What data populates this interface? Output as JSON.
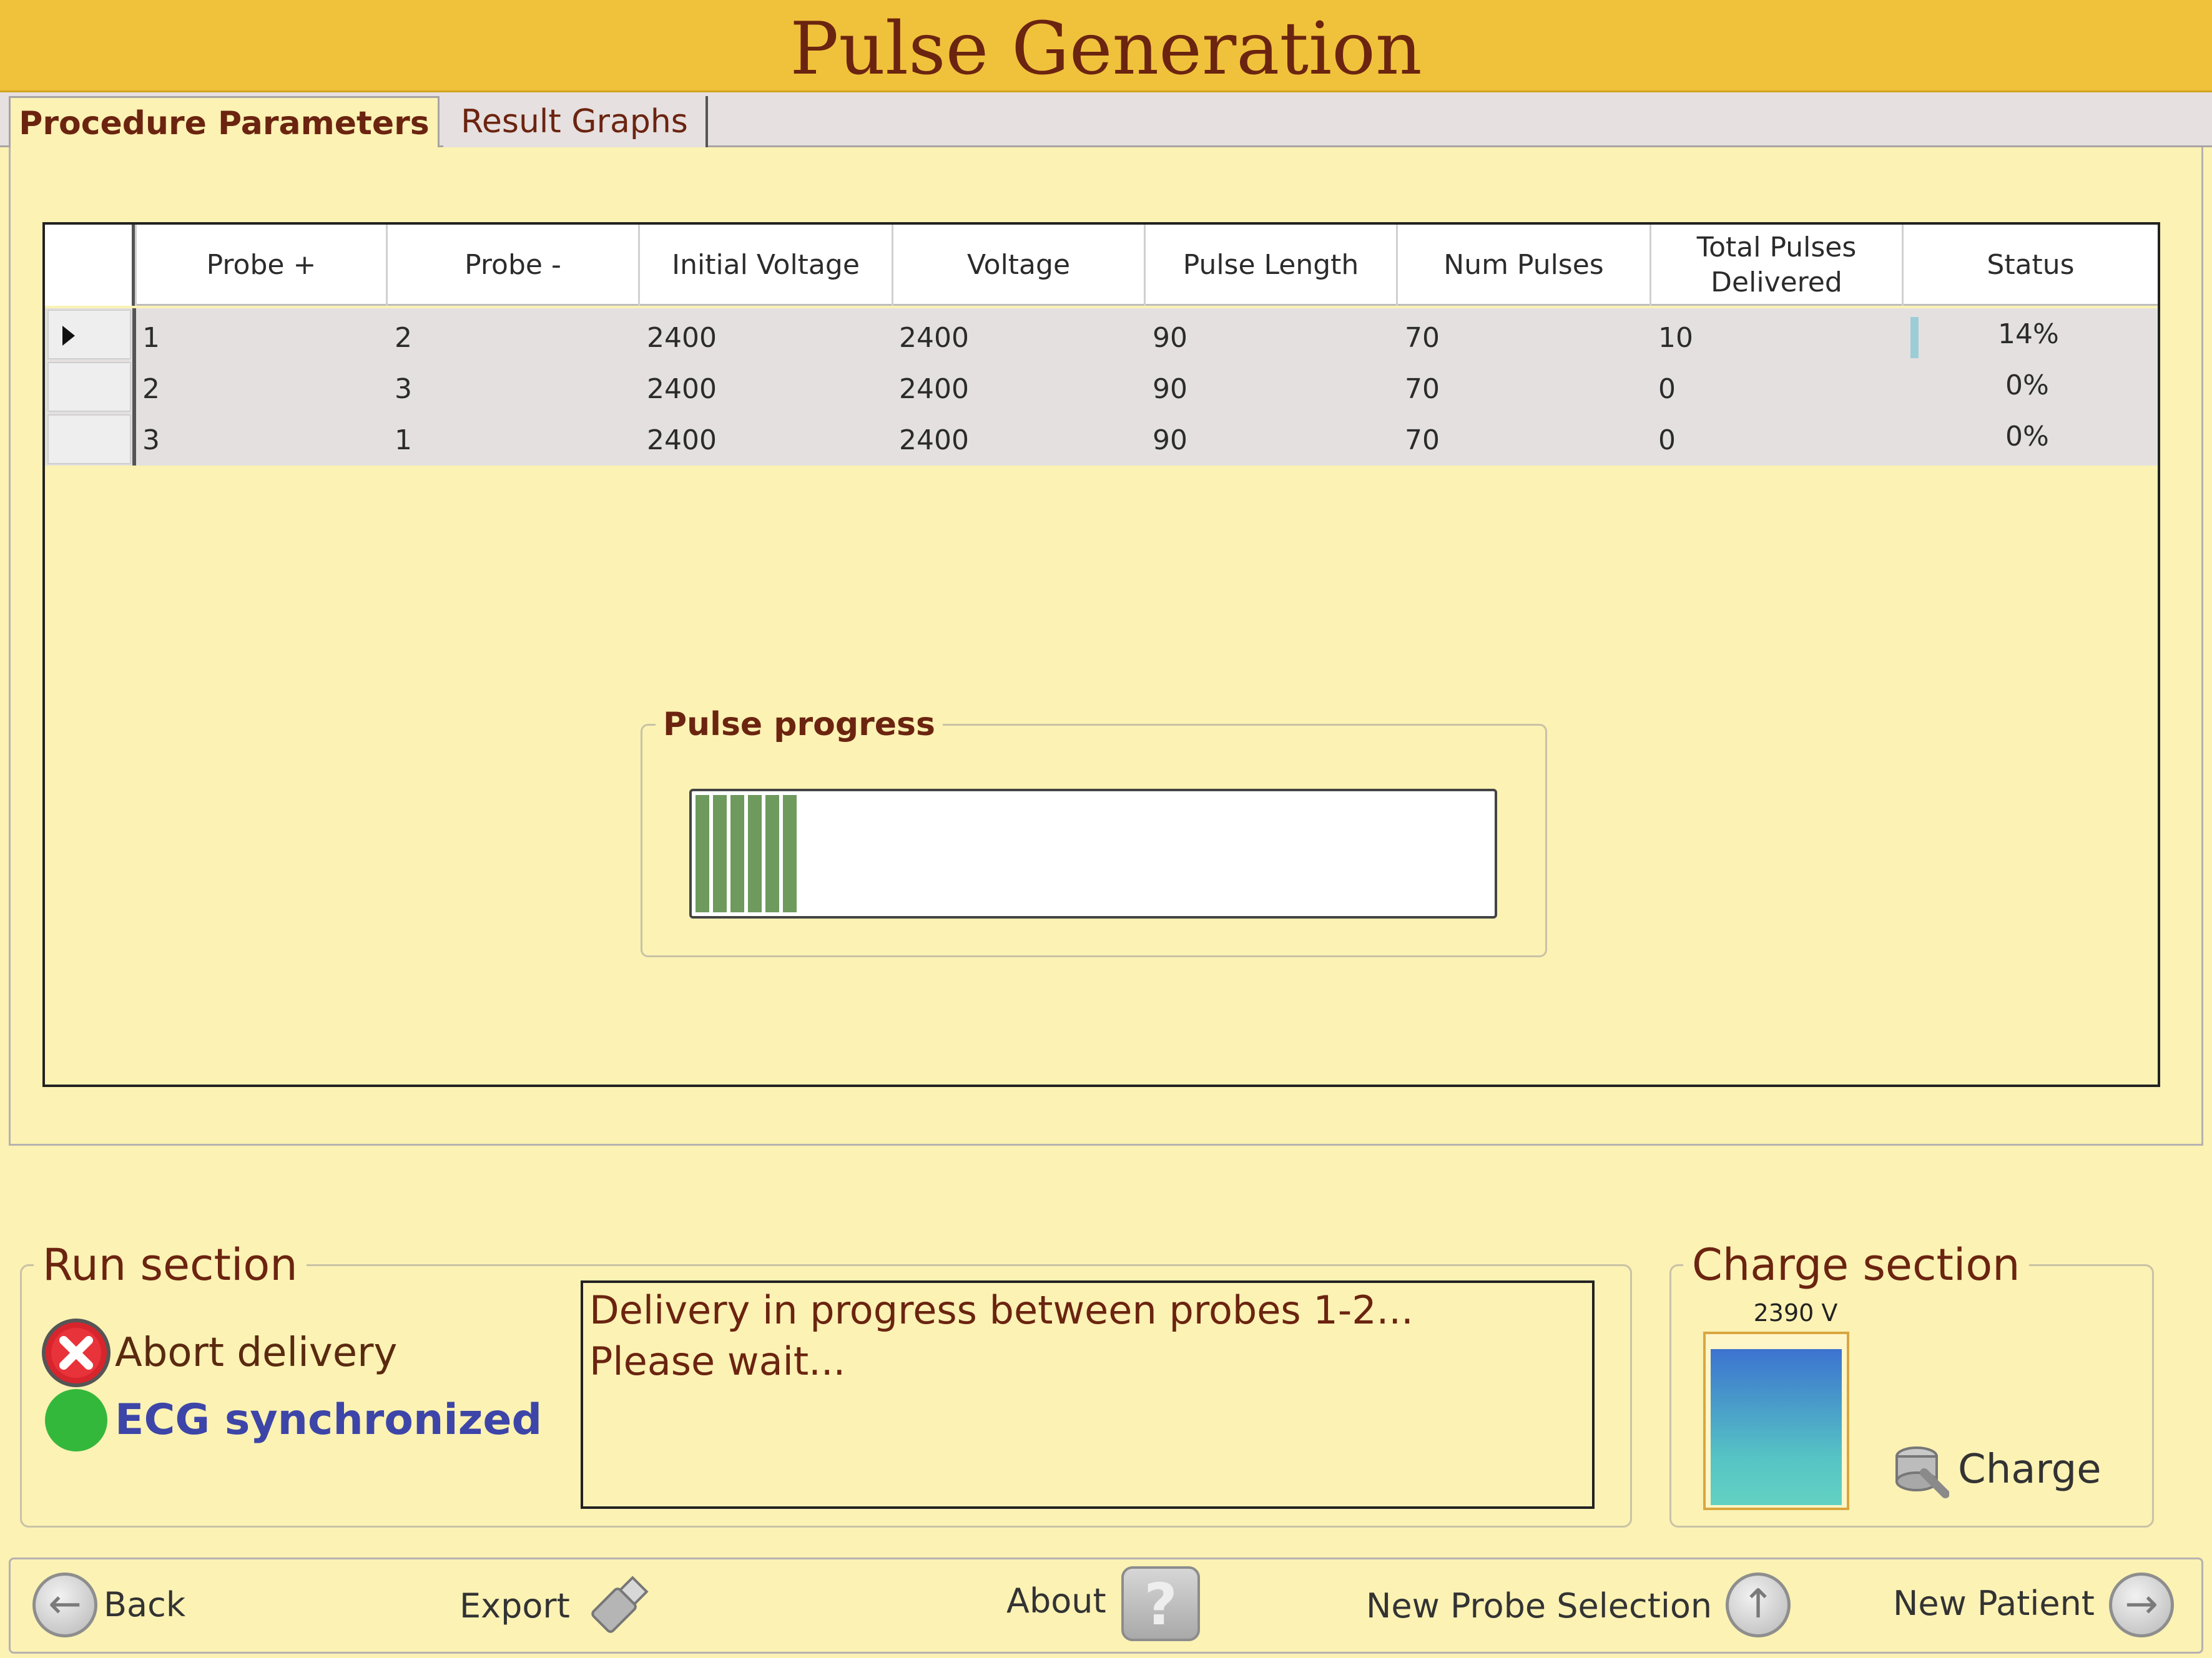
{
  "window": {
    "title": "Pulse Generation"
  },
  "tabs": [
    {
      "label": "Procedure Parameters",
      "active": true
    },
    {
      "label": "Result Graphs",
      "active": false
    }
  ],
  "table": {
    "columns": [
      "Probe +",
      "Probe -",
      "Initial Voltage",
      "Voltage",
      "Pulse Length",
      "Num Pulses",
      "Total Pulses Delivered",
      "Status"
    ],
    "rows": [
      {
        "probe_plus": "1",
        "probe_minus": "2",
        "initial_voltage": "2400",
        "voltage": "2400",
        "pulse_length": "90",
        "num_pulses": "70",
        "total_delivered": "10",
        "status": "14%",
        "status_fraction": 0.14,
        "selected": true
      },
      {
        "probe_plus": "2",
        "probe_minus": "3",
        "initial_voltage": "2400",
        "voltage": "2400",
        "pulse_length": "90",
        "num_pulses": "70",
        "total_delivered": "0",
        "status": "0%",
        "status_fraction": 0
      },
      {
        "probe_plus": "3",
        "probe_minus": "1",
        "initial_voltage": "2400",
        "voltage": "2400",
        "pulse_length": "90",
        "num_pulses": "70",
        "total_delivered": "0",
        "status": "0%",
        "status_fraction": 0
      }
    ]
  },
  "pulse_progress": {
    "label": "Pulse progress",
    "fraction": 0.14,
    "fill_color": "#6e9a5e"
  },
  "run_section": {
    "label": "Run section",
    "abort_label": "Abort delivery",
    "ecg_label": "ECG synchronized",
    "message_line1": "Delivery in progress between probes 1-2...",
    "message_line2": "Please wait..."
  },
  "charge_section": {
    "label": "Charge section",
    "voltage_readout": "2390 V",
    "charge_label": "Charge"
  },
  "bottom_bar": {
    "back_label": "Back",
    "export_label": "Export",
    "about_label": "About",
    "new_probe_label": "New Probe Selection",
    "new_patient_label": "New Patient"
  },
  "colors": {
    "title_bar": "#f0c23c",
    "panel_bg": "#fbf2b4",
    "accent_text": "#6b2410",
    "ecg_blue": "#3d45a8",
    "ecg_green": "#34b83c",
    "abort_red": "#d8242c"
  },
  "icons": [
    "row-pointer-icon",
    "abort-icon",
    "ecg-status-icon",
    "charge-icon",
    "back-arrow-icon",
    "usb-icon",
    "help-icon",
    "up-arrow-icon",
    "right-arrow-icon"
  ]
}
